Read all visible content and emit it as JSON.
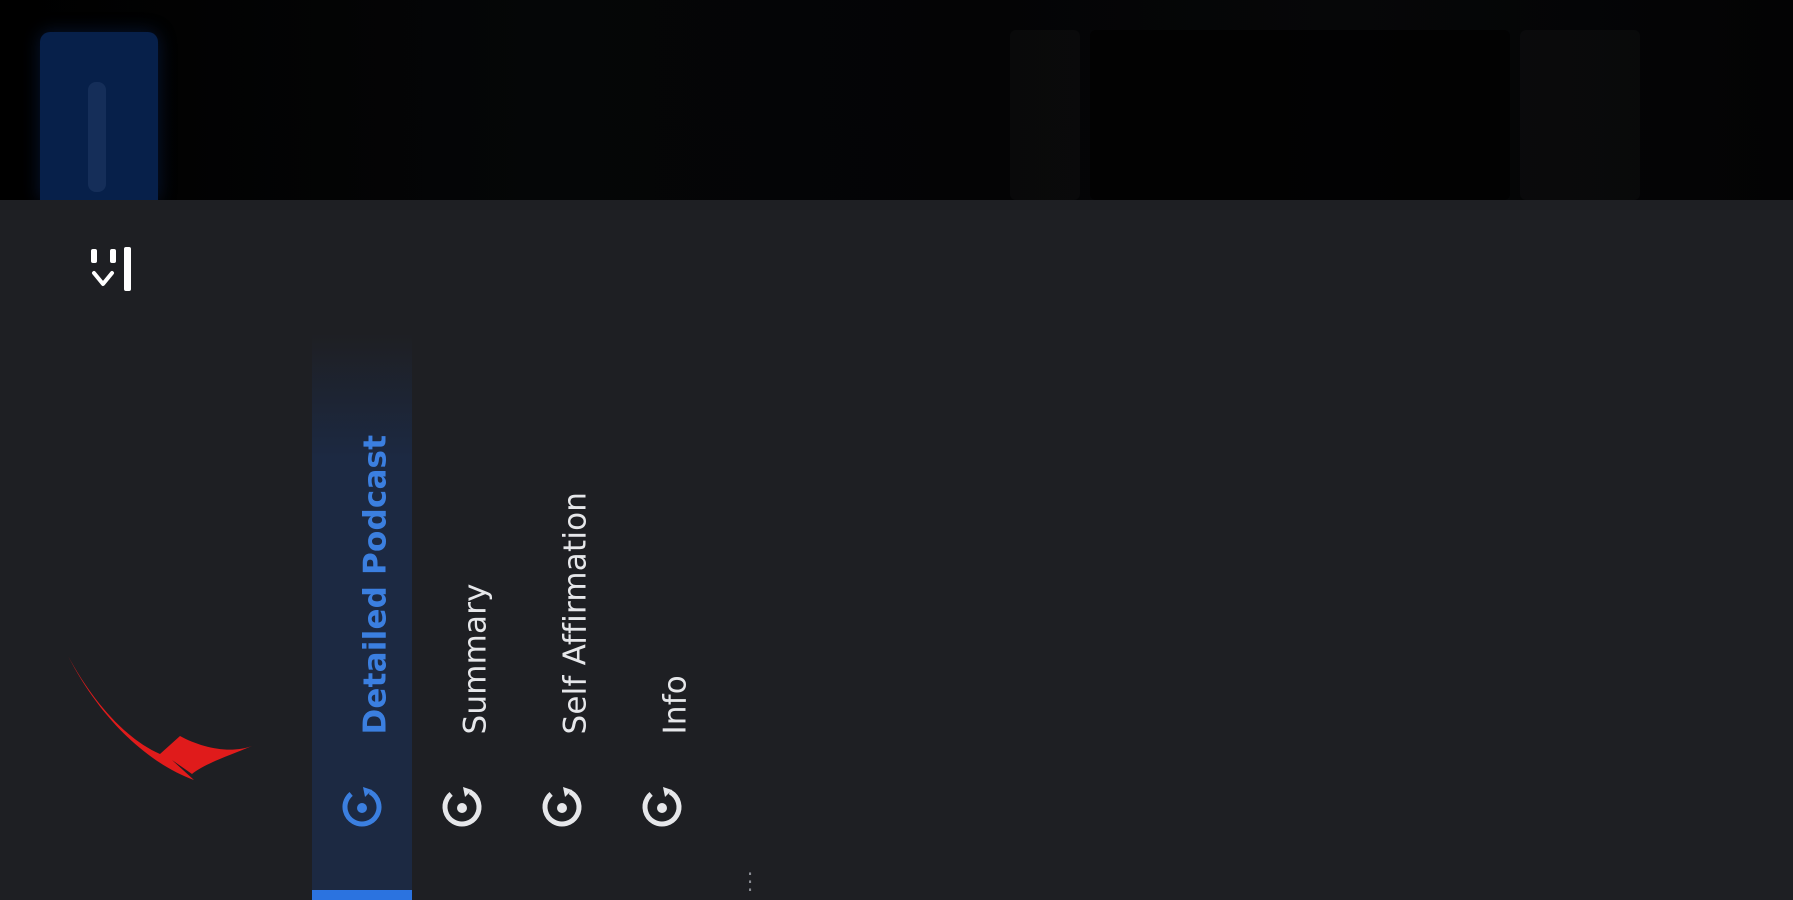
{
  "tabs": [
    {
      "label": "Detailed Podcast",
      "active": true
    },
    {
      "label": "Summary",
      "active": false
    },
    {
      "label": "Self Affirmation",
      "active": false
    },
    {
      "label": "Info",
      "active": false
    }
  ],
  "icons": {
    "sidebar_toggle": "collapse-sidebar-icon",
    "tab_icon": "replay-icon",
    "annotation": "red-arrow-annotation",
    "overflow": "more-vertical-icon"
  },
  "colors": {
    "background": "#1e1f23",
    "active_accent": "#2b73e0",
    "active_text": "#3b7fe0",
    "text": "#e6e7ea",
    "annotation": "#e01b1b"
  }
}
